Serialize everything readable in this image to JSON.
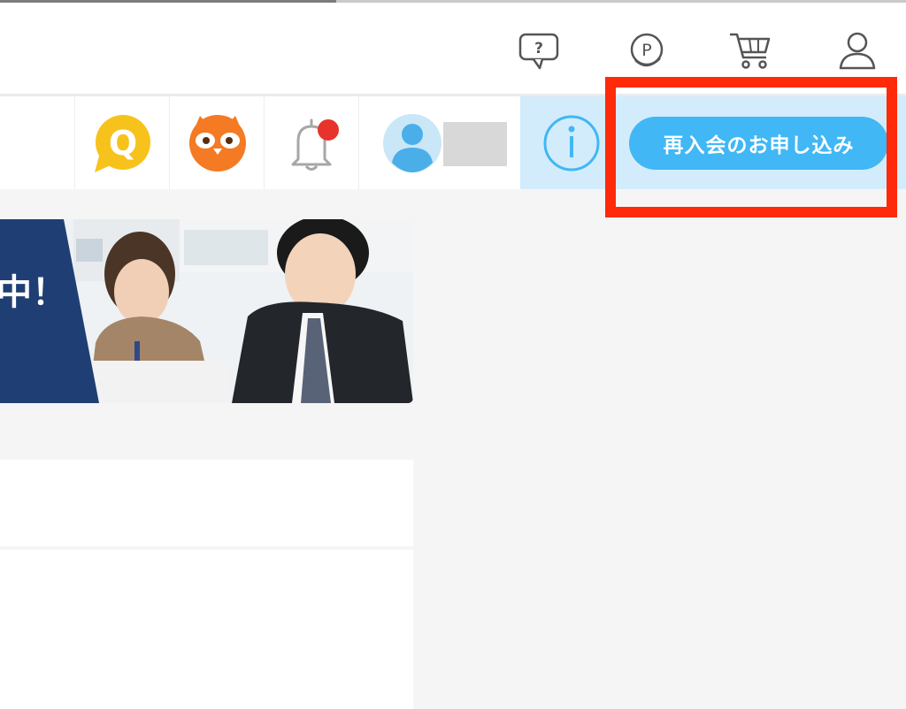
{
  "header": {
    "icons": [
      "help-bubble-icon",
      "points-coin-icon",
      "cart-icon",
      "user-icon"
    ]
  },
  "subnav": {
    "qa_letter": "Q",
    "notification_badge": true,
    "cta_label": "再入会のお申し込み"
  },
  "banner": {
    "visible_text": "中！"
  },
  "colors": {
    "accent_blue": "#41b7f5",
    "info_bg": "#d3ecfb",
    "highlight_red": "#ff2a0a",
    "qa_yellow": "#f7c21b",
    "owl_orange": "#f47a23",
    "banner_navy": "#1f3f74"
  }
}
